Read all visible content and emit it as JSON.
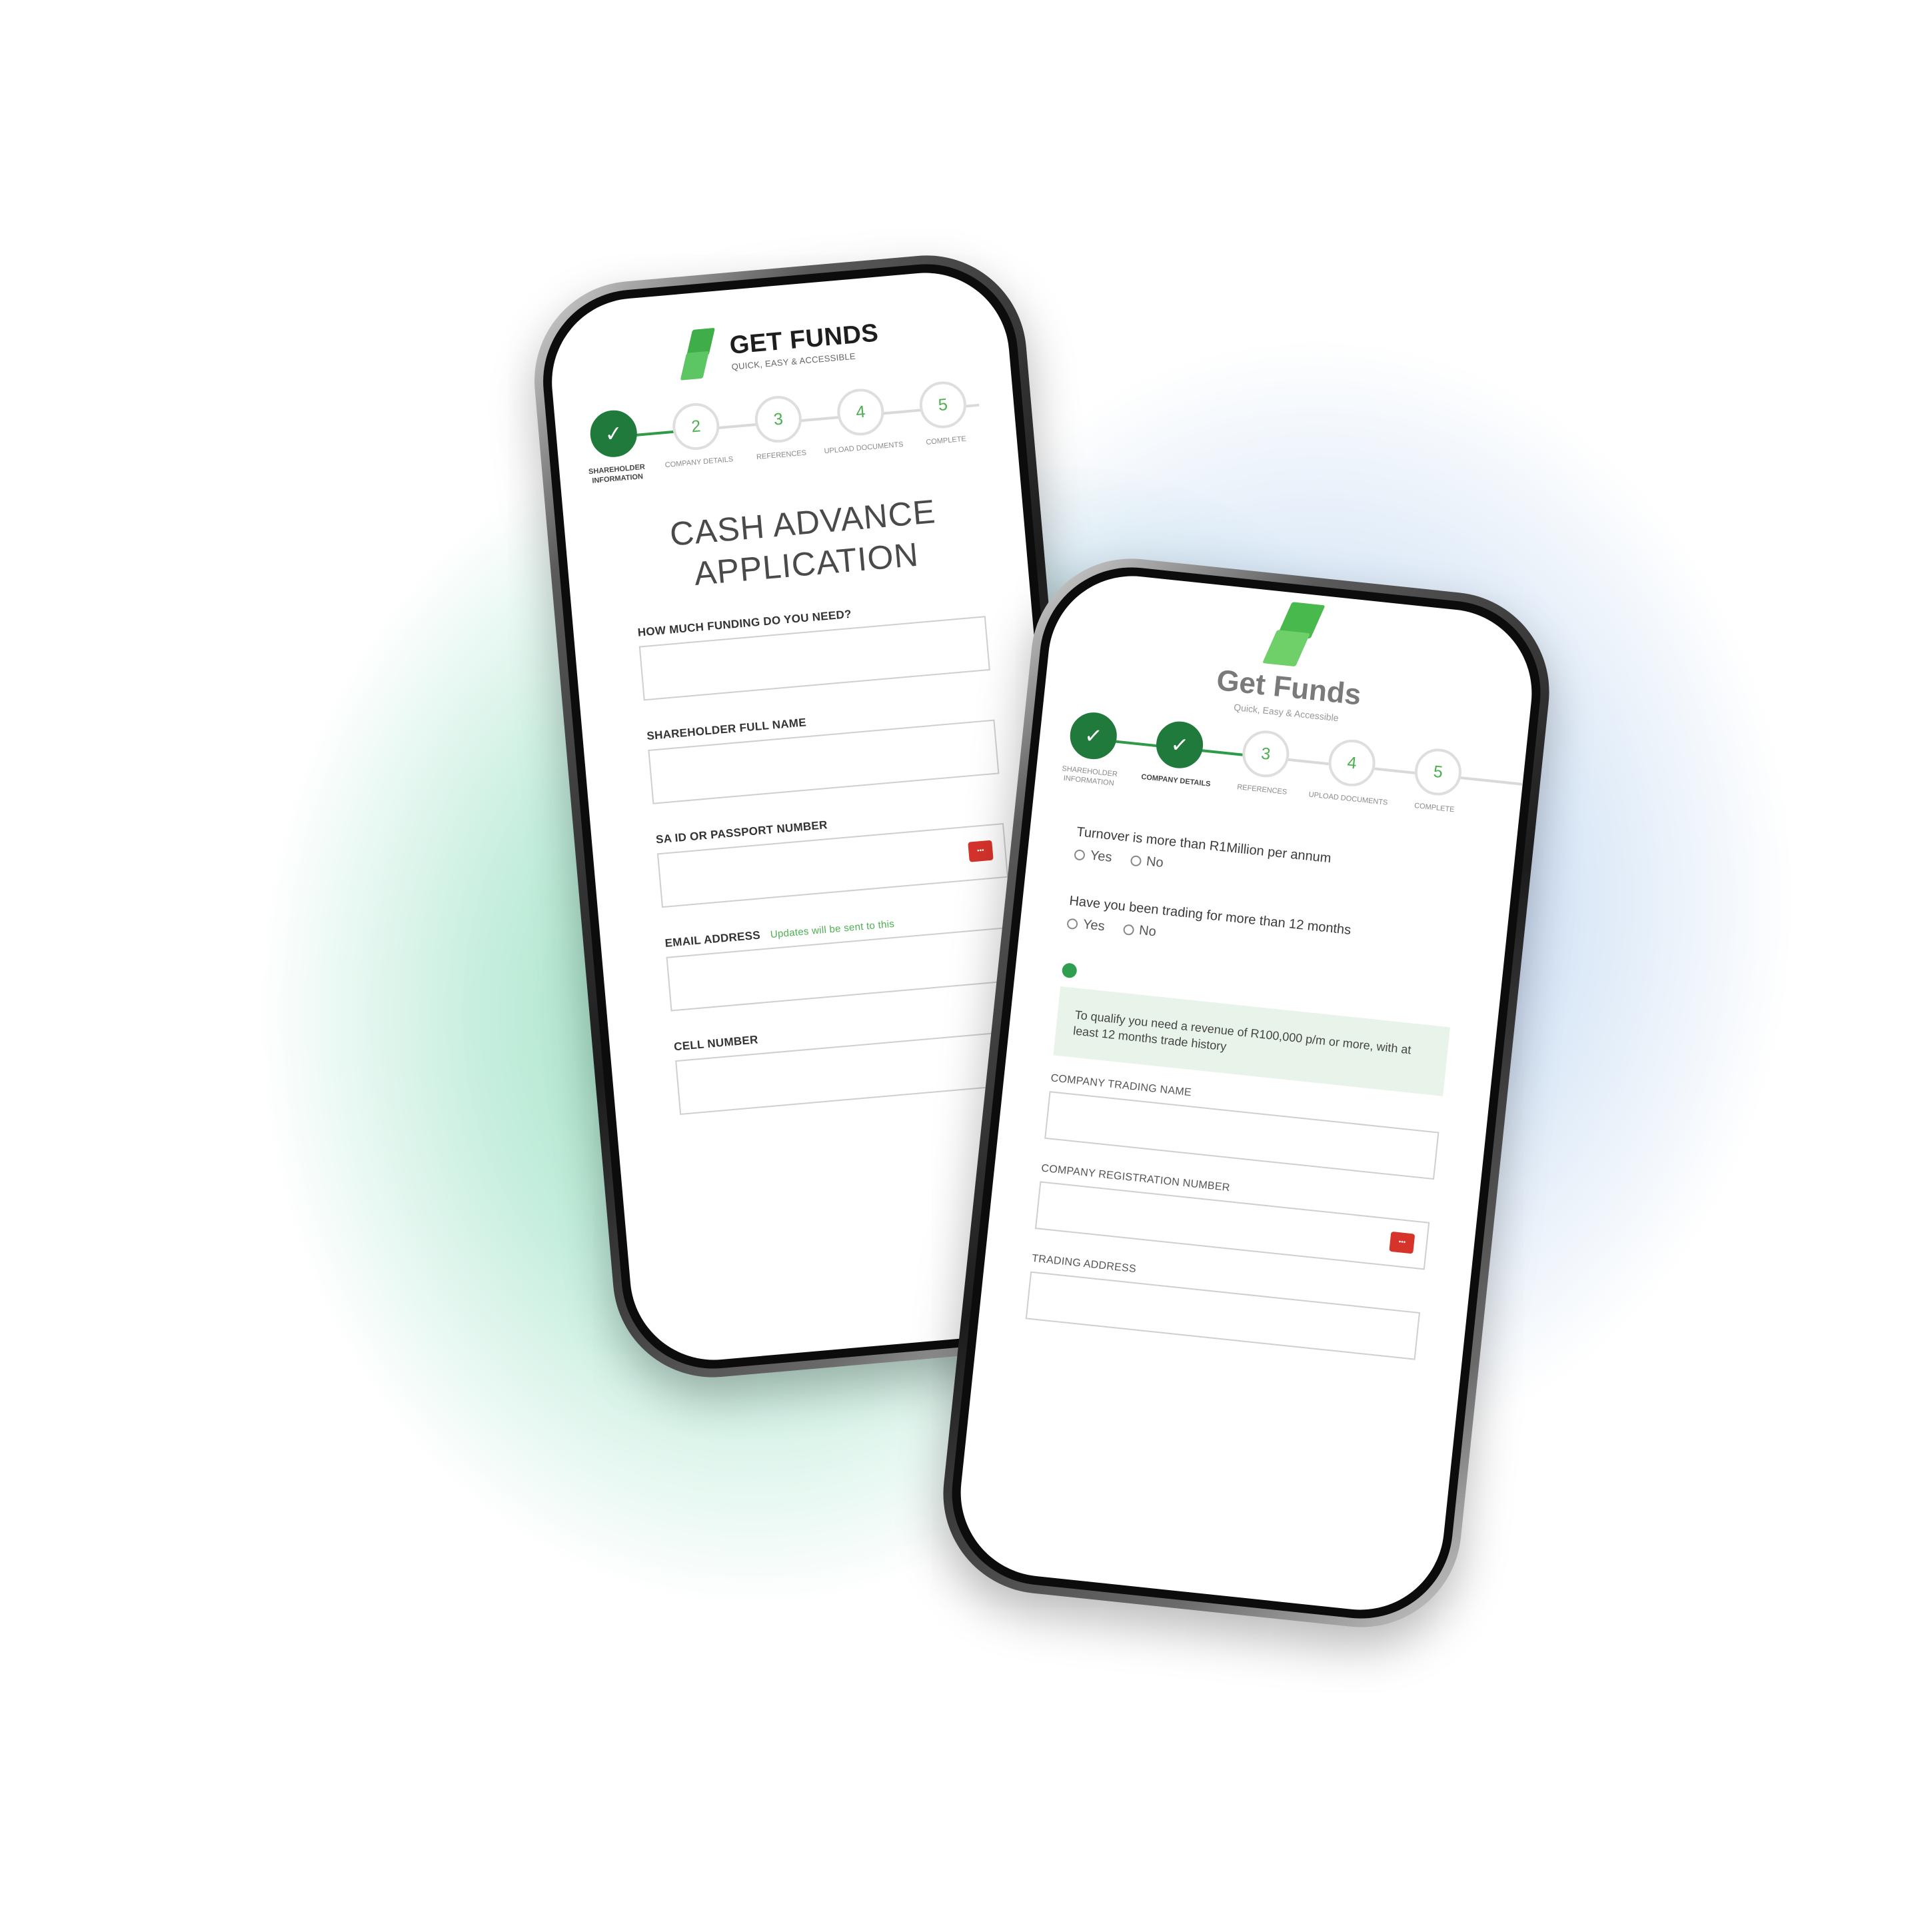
{
  "colors": {
    "brand_green": "#3fae49",
    "step_done": "#1f7a3b",
    "badge_red": "#d6332b",
    "info_bg": "#e8f4ea"
  },
  "phone_1": {
    "brand": {
      "name": "GET FUNDS",
      "tagline": "QUICK, EASY & ACCESSIBLE"
    },
    "steps": [
      {
        "number": "2",
        "label": "COMPANY DETAILS"
      },
      {
        "number": "3",
        "label": "REFERENCES"
      },
      {
        "number": "4",
        "label": "UPLOAD DOCUMENTS"
      },
      {
        "number": "5",
        "label": "COMPLETE"
      }
    ],
    "step_1": {
      "check": "✓",
      "label": "SHAREHOLDER INFORMATION"
    },
    "title_line_1": "CASH ADVANCE",
    "title_line_2": "APPLICATION",
    "fields": {
      "funding": "HOW MUCH FUNDING DO YOU NEED?",
      "full_name": "SHAREHOLDER FULL NAME",
      "id_number": "SA ID OR PASSPORT NUMBER",
      "email": "EMAIL ADDRESS",
      "email_note": "Updates will be sent to this",
      "cell": "CELL NUMBER"
    }
  },
  "phone_2": {
    "brand": {
      "name": "Get Funds",
      "tagline": "Quick, Easy & Accessible"
    },
    "step_1": {
      "check": "✓",
      "label": "SHAREHOLDER INFORMATION"
    },
    "step_2": {
      "check": "✓",
      "label": "COMPANY DETAILS"
    },
    "steps": [
      {
        "number": "3",
        "label": "REFERENCES"
      },
      {
        "number": "4",
        "label": "UPLOAD DOCUMENTS"
      },
      {
        "number": "5",
        "label": "COMPLETE"
      }
    ],
    "turnover_question": "Turnover is more than R1Million per annum",
    "trading_question": "Have you been trading for more than 12 months",
    "yes": "Yes",
    "no": "No",
    "info": "To qualify you need a revenue of R100,000 p/m or more, with at least 12 months trade history",
    "fields": {
      "trading_name": "COMPANY TRADING NAME",
      "registration": "COMPANY REGISTRATION NUMBER",
      "address": "TRADING ADDRESS"
    }
  }
}
